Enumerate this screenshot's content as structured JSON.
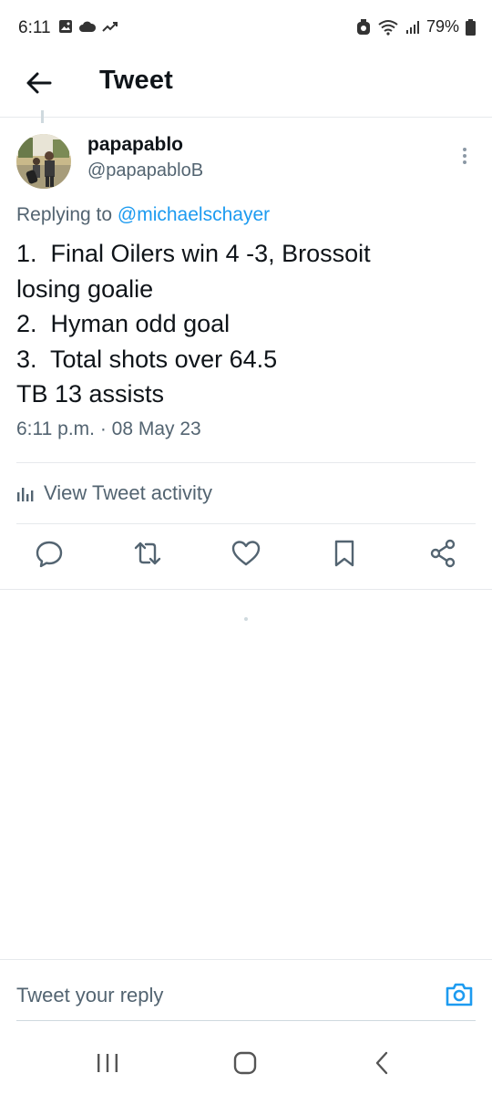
{
  "status_bar": {
    "time": "6:11",
    "battery": "79%",
    "left_icons": [
      "image-icon",
      "cloud-icon",
      "trend-icon"
    ],
    "right_icons": [
      "alarm-icon",
      "wifi-icon",
      "signal-icon",
      "battery-icon"
    ]
  },
  "header": {
    "title": "Tweet"
  },
  "tweet": {
    "display_name": "papapablo",
    "handle": "@papapabloB",
    "replying_prefix": "Replying to ",
    "replying_to": "@michaelschayer",
    "lines": [
      "1.  Final Oilers win 4 -3, Brossoit",
      "losing goalie",
      "2.  Hyman odd goal",
      "3.  Total shots over 64.5",
      "TB 13 assists"
    ],
    "timestamp": "6:11 p.m. · 08 May 23",
    "activity_label": "View Tweet activity"
  },
  "actions": [
    "reply-icon",
    "retweet-icon",
    "like-icon",
    "bookmark-icon",
    "share-icon"
  ],
  "reply": {
    "placeholder": "Tweet your reply"
  },
  "colors": {
    "accent": "#1d9bf0",
    "secondary_text": "#536471",
    "divider": "#e6e9ec"
  }
}
